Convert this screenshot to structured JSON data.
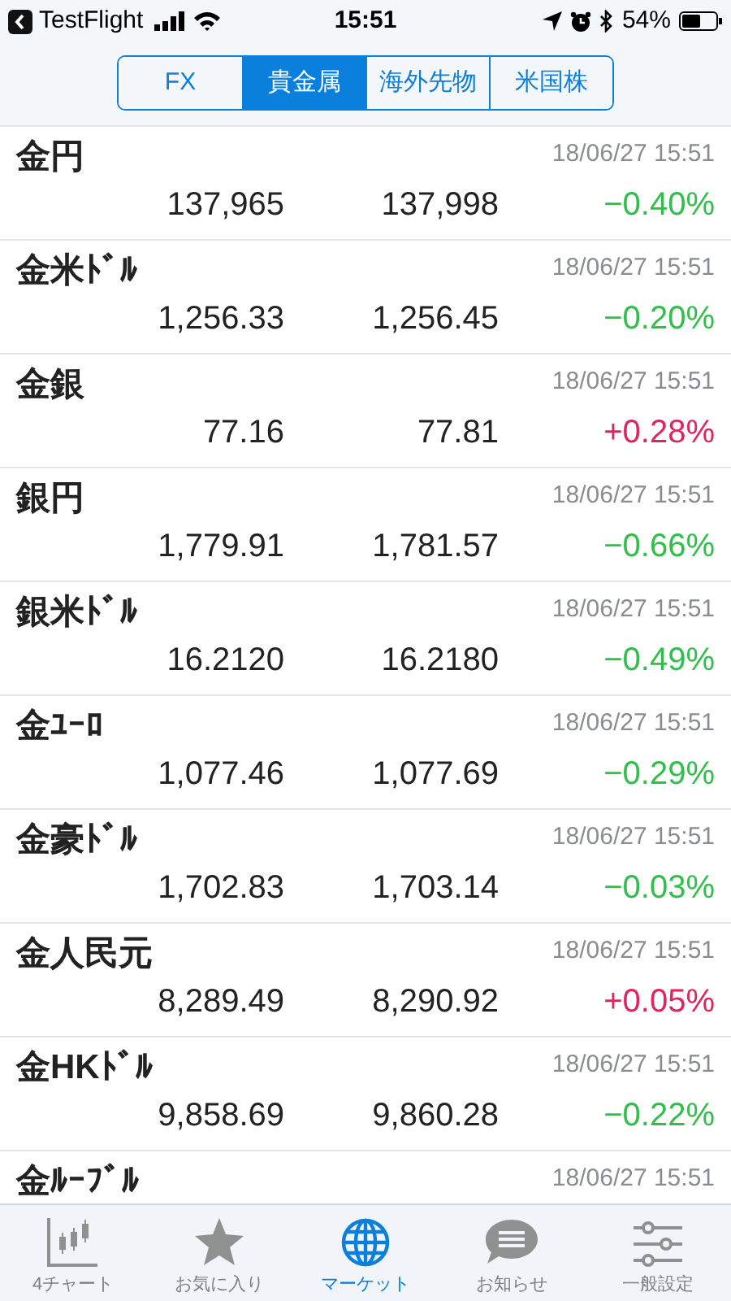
{
  "status_bar": {
    "back_app": "TestFlight",
    "time": "15:51",
    "battery": "54%"
  },
  "segments": [
    {
      "label": "FX",
      "selected": false
    },
    {
      "label": "貴金属",
      "selected": true
    },
    {
      "label": "海外先物",
      "selected": false
    },
    {
      "label": "米国株",
      "selected": false
    }
  ],
  "rows": [
    {
      "name": "金円",
      "time": "18/06/27 15:51",
      "bid": "137,965",
      "ask": "137,998",
      "change": "−0.40%",
      "color": "#2fbf4a"
    },
    {
      "name": "金米ﾄﾞﾙ",
      "time": "18/06/27 15:51",
      "bid": "1,256.33",
      "ask": "1,256.45",
      "change": "−0.20%",
      "color": "#2fbf4a"
    },
    {
      "name": "金銀",
      "time": "18/06/27 15:51",
      "bid": "77.16",
      "ask": "77.81",
      "change": "+0.28%",
      "color": "#e0245e"
    },
    {
      "name": "銀円",
      "time": "18/06/27 15:51",
      "bid": "1,779.91",
      "ask": "1,781.57",
      "change": "−0.66%",
      "color": "#2fbf4a"
    },
    {
      "name": "銀米ﾄﾞﾙ",
      "time": "18/06/27 15:51",
      "bid": "16.2120",
      "ask": "16.2180",
      "change": "−0.49%",
      "color": "#2fbf4a"
    },
    {
      "name": "金ﾕｰﾛ",
      "time": "18/06/27 15:51",
      "bid": "1,077.46",
      "ask": "1,077.69",
      "change": "−0.29%",
      "color": "#2fbf4a"
    },
    {
      "name": "金豪ﾄﾞﾙ",
      "time": "18/06/27 15:51",
      "bid": "1,702.83",
      "ask": "1,703.14",
      "change": "−0.03%",
      "color": "#2fbf4a"
    },
    {
      "name": "金人民元",
      "time": "18/06/27 15:51",
      "bid": "8,289.49",
      "ask": "8,290.92",
      "change": "+0.05%",
      "color": "#e0245e"
    },
    {
      "name": "金HKﾄﾞﾙ",
      "time": "18/06/27 15:51",
      "bid": "9,858.69",
      "ask": "9,860.28",
      "change": "−0.22%",
      "color": "#2fbf4a"
    },
    {
      "name": "金ﾙｰﾌﾞﾙ",
      "time": "18/06/27 15:51"
    }
  ],
  "tab_bar": [
    {
      "label": "4チャート",
      "selected": false
    },
    {
      "label": "お気に入り",
      "selected": false
    },
    {
      "label": "マーケット",
      "selected": true
    },
    {
      "label": "お知らせ",
      "selected": false
    },
    {
      "label": "一般設定",
      "selected": false
    }
  ]
}
